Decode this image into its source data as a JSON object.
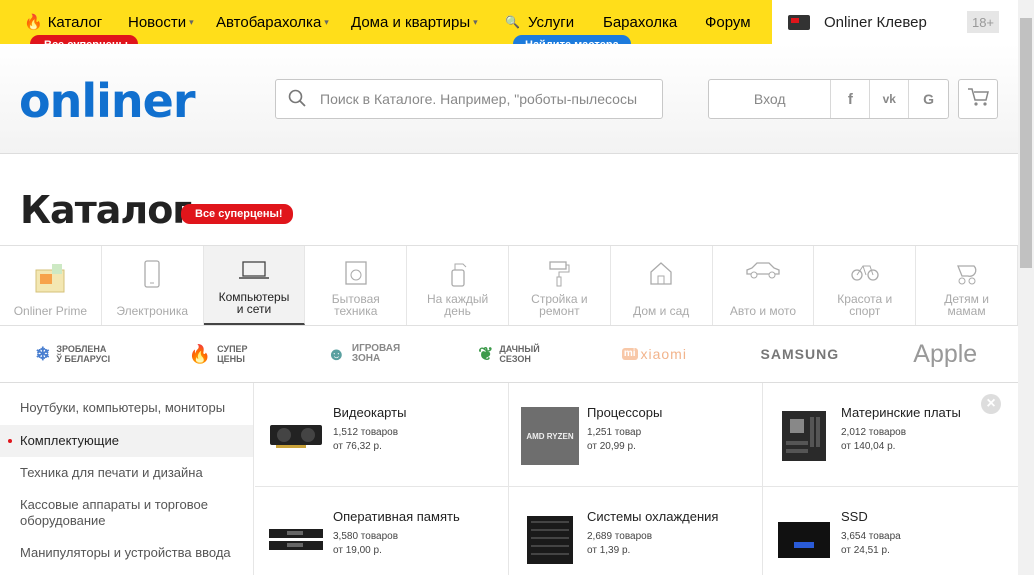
{
  "topnav": {
    "items": [
      {
        "label": "Каталог",
        "icon": "fire-icon"
      },
      {
        "label": "Новости",
        "chevron": true
      },
      {
        "label": "Автобарахолка",
        "chevron": true
      },
      {
        "label": "Дома и квартиры",
        "chevron": true
      },
      {
        "label": "Услуги",
        "icon": "search-icon"
      },
      {
        "label": "Барахолка"
      },
      {
        "label": "Форум"
      }
    ],
    "badge_catalog": "Все суперцены",
    "badge_services": "Найдите мастера",
    "clever_label": "Onliner Клевер",
    "age_label": "18+"
  },
  "header": {
    "logo": "onliner",
    "search_placeholder": "Поиск в Каталоге. Например, \"роботы-пылесосы",
    "login_label": "Вход",
    "social": [
      "f",
      "vk",
      "G"
    ]
  },
  "page": {
    "title": "Каталог",
    "title_badge": "Все суперцены!"
  },
  "categories": [
    {
      "label": "Onliner Prime"
    },
    {
      "label": "Электроника"
    },
    {
      "label": "Компьютеры и сети",
      "active": true
    },
    {
      "label": "Бытовая техника"
    },
    {
      "label": "На каждый день"
    },
    {
      "label": "Стройка и ремонт"
    },
    {
      "label": "Дом и сад"
    },
    {
      "label": "Авто и мото"
    },
    {
      "label": "Красота и спорт"
    },
    {
      "label": "Детям и мамам"
    }
  ],
  "brands": [
    {
      "line1": "ЗРОБЛЕНА",
      "line2": "Ў БЕЛАРУСІ"
    },
    {
      "line1": "СУПЕР",
      "line2": "ЦЕНЫ"
    },
    {
      "line1": "ИГРОВАЯ",
      "line2": "ЗОНА"
    },
    {
      "line1": "ДАЧНЫЙ",
      "line2": "СЕЗОН"
    },
    {
      "line1": "xiaomi"
    },
    {
      "line1": "SAMSUNG"
    },
    {
      "line1": "Apple"
    }
  ],
  "sidebar": {
    "items": [
      {
        "label": "Ноутбуки, компьютеры, мониторы"
      },
      {
        "label": "Комплектующие",
        "active": true
      },
      {
        "label": "Техника для печати и дизайна"
      },
      {
        "label": "Кассовые аппараты и торговое оборудование"
      },
      {
        "label": "Манипуляторы и устройства ввода"
      }
    ]
  },
  "products": [
    {
      "name": "Видеокарты",
      "count": "1,512 товаров",
      "price": "от 76,32 р."
    },
    {
      "name": "Процессоры",
      "count": "1,251 товар",
      "price": "от 20,99 р."
    },
    {
      "name": "Материнские платы",
      "count": "2,012 товаров",
      "price": "от 140,04 р."
    },
    {
      "name": "Оперативная память",
      "count": "3,580 товаров",
      "price": "от 19,00 р."
    },
    {
      "name": "Системы охлаждения",
      "count": "2,689 товаров",
      "price": "от 1,39 р."
    },
    {
      "name": "SSD",
      "count": "3,654 товара",
      "price": "от 24,51 р."
    }
  ],
  "cpu_chip_text": "AMD RYZEN",
  "close_glyph": "×",
  "colors": {
    "yellow": "#ffde1a",
    "red": "#e0151b",
    "blue": "#1170cf"
  }
}
